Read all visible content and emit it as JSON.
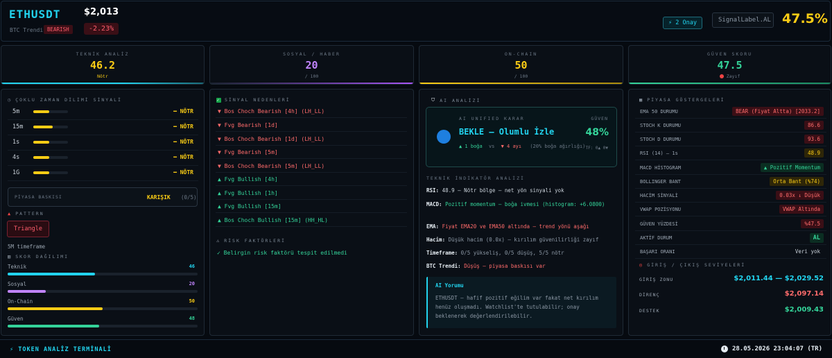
{
  "header": {
    "symbol": "ETHUSDT",
    "price": "$2,013",
    "btc_trend_label": "BTC Trendi:",
    "btc_trend_value": "BEARISH",
    "change": "-2.23%",
    "approvals": "⚡ 2 Onay",
    "signal_label": "SignalLabel.AL",
    "confidence": "47.5%"
  },
  "score_cards": [
    {
      "title": "TEKNİK ANALİZ",
      "value": "46.2",
      "sub": "Nötr",
      "color": "#facc15"
    },
    {
      "title": "SOSYAL / HABER",
      "value": "20",
      "sub": "/ 100",
      "color": "#c084fc"
    },
    {
      "title": "ON-CHAIN",
      "value": "50",
      "sub": "/ 100",
      "color": "#facc15"
    },
    {
      "title": "GÜVEN SKORU",
      "value": "47.5",
      "sub": "Zayıf",
      "color": "#34d399"
    }
  ],
  "timeframes": {
    "title": "ÇOKLU ZAMAN DİLİMİ SİNYALİ",
    "rows": [
      {
        "label": "5m",
        "signal": "━ NÖTR",
        "level": 0.45
      },
      {
        "label": "15m",
        "signal": "━ NÖTR",
        "level": 0.55
      },
      {
        "label": "1s",
        "signal": "━ NÖTR",
        "level": 0.45
      },
      {
        "label": "4s",
        "signal": "━ NÖTR",
        "level": 0.45
      },
      {
        "label": "1G",
        "signal": "━ NÖTR",
        "level": 0.45
      }
    ],
    "pressure_label": "PİYASA BASKISI",
    "pressure_value": "KARIŞIK",
    "pressure_count": "(0/5)"
  },
  "pattern": {
    "title": "PATTERN",
    "name": "Triangle",
    "timeframe_note": "5M timeframe"
  },
  "score_distribution": {
    "title": "SKOR DAĞILIMI",
    "rows": [
      {
        "label": "Teknik",
        "value": "46",
        "pct": 46,
        "color": "#22d3ee"
      },
      {
        "label": "Sosyal",
        "value": "20",
        "pct": 20,
        "color": "#c084fc"
      },
      {
        "label": "On-Chain",
        "value": "50",
        "pct": 50,
        "color": "#facc15"
      },
      {
        "label": "Güven",
        "value": "48",
        "pct": 48,
        "color": "#34d399"
      }
    ]
  },
  "signal_reasons": {
    "title": "SİNYAL NEDENLERİ",
    "items": [
      {
        "text": "▼ Bos Choch Bearish [4h] (LH_LL)",
        "kind": "bear"
      },
      {
        "text": "▼ Fvg Bearish [1d]",
        "kind": "bear"
      },
      {
        "text": "▼ Bos Choch Bearish [1d] (LH_LL)",
        "kind": "bear"
      },
      {
        "text": "▼ Fvg Bearish [5m]",
        "kind": "bear"
      },
      {
        "text": "▼ Bos Choch Bearish [5m] (LH_LL)",
        "kind": "bear"
      },
      {
        "text": "▲ Fvg Bullish [4h]",
        "kind": "bull"
      },
      {
        "text": "▲ Fvg Bullish [1h]",
        "kind": "bull"
      },
      {
        "text": "▲ Fvg Bullish [15m]",
        "kind": "bull"
      },
      {
        "text": "▲ Bos Choch Bullish [15m] (HH_HL)",
        "kind": "bull"
      }
    ],
    "risk_title": "RİSK FAKTÖRLERİ",
    "risk_text": "✓ Belirgin risk faktörü tespit edilmedi"
  },
  "ai": {
    "title": "AI ANALİZİ",
    "caption": "AI UNIFIED KARAR",
    "confidence_caption": "GÜVEN",
    "decision": "BEKLE — Olumlu İzle",
    "confidence": "48%",
    "bull_votes": "▲ 1 boğa",
    "vs": "vs",
    "bear_votes": "▼ 4 ayı",
    "weight_note": "(20% boğa ağırlığı)",
    "tf_note": "TF: 0▲ 0▼",
    "indicator_title": "TEKNİK İNDİKATÖR ANALİZİ",
    "indicators": [
      {
        "label": "RSI:",
        "text": "48.9 — Nötr bölge — net yön sinyali yok",
        "color": "#c9d1d9"
      },
      {
        "label": "MACD:",
        "text": "Pozitif momentum — boğa ivmesi (histogram: +6.0800)",
        "color": "#34d399"
      },
      {
        "label": "EMA:",
        "text": "Fiyat EMA20 ve EMA50 altında — trend yönü aşağı",
        "color": "#ff6b6b"
      },
      {
        "label": "Hacim:",
        "text": "Düşük hacim (0.0x) — kırılım güvenilirliği zayıf",
        "color": "#8b97a4"
      },
      {
        "label": "Timeframe:",
        "text": "0/5 yükseliş, 0/5 düşüş, 5/5 nötr",
        "color": "#8b97a4"
      },
      {
        "label": "BTC Trendi:",
        "text": "Düşüş — piyasa baskısı var",
        "color": "#ff6b6b"
      }
    ],
    "comment_title": "AI Yorumu",
    "comment_text": "ETHUSDT — hafif pozitif eğilim var fakat net kırılım henüz oluşmadı. Watchlist'te tutulabilir; onay beklenerek değerlendirilebilir."
  },
  "market": {
    "title": "PİYASA GÖSTERGELERİ",
    "rows": [
      {
        "label": "EMA 50 DURUMU",
        "value": "BEAR (Fiyat Altta) [2033.2]",
        "style": "b-red"
      },
      {
        "label": "STOCH K DURUMU",
        "value": "86.6",
        "style": "b-red"
      },
      {
        "label": "STOCH D DURUMU",
        "value": "93.6",
        "style": "b-red"
      },
      {
        "label": "RSI (14) — 1s",
        "value": "48.9",
        "style": "b-yel"
      },
      {
        "label": "MACD HİSTOGRAM",
        "value": "▲ Pozitif Momentum",
        "style": "b-grn"
      },
      {
        "label": "BOLLINGER BANT",
        "value": "Orta Bant (%74)",
        "style": "b-yel"
      },
      {
        "label": "HACİM SİNYALİ",
        "value": "0.03x ↓ Düşük",
        "style": "b-red"
      },
      {
        "label": "VWAP POZİSYONU",
        "value": "VWAP Altında",
        "style": "b-red"
      },
      {
        "label": "GÜVEN YÜZDESİ",
        "value": "%47.5",
        "style": "b-red"
      },
      {
        "label": "AKTİF DURUM",
        "value": "AL",
        "style": "b-grn"
      },
      {
        "label": "BAŞARI ORANI",
        "value": "Veri yok",
        "style": "b-none"
      }
    ],
    "levels_title": "GİRİŞ / ÇIKIŞ SEVİYELERİ",
    "levels": [
      {
        "label": "GİRİŞ ZONU",
        "value": "$2,011.44 — $2,029.52",
        "color": "#22d3ee"
      },
      {
        "label": "DİRENÇ",
        "value": "$2,097.14",
        "color": "#ff6b6b"
      },
      {
        "label": "DESTEK",
        "value": "$2,009.43",
        "color": "#34d399"
      }
    ]
  },
  "footer": {
    "title": "⚡ TOKEN ANALİZ TERMİNALİ",
    "datetime": "28.05.2026 23:04:07 (TR)"
  }
}
